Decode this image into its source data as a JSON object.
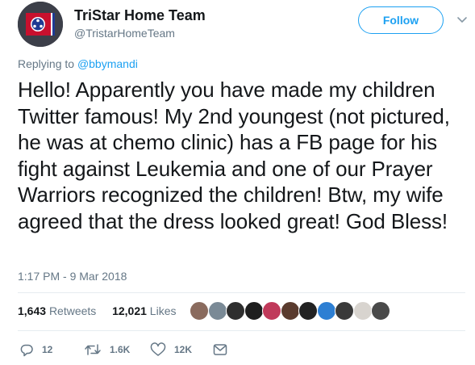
{
  "author": {
    "display_name": "TriStar Home Team",
    "handle": "@TristarHomeTeam",
    "avatar_icon": "tennessee-flag-avatar"
  },
  "header": {
    "follow_label": "Follow",
    "menu_icon": "chevron-down-icon"
  },
  "reply": {
    "prefix": "Replying to",
    "mention": "@bbymandi"
  },
  "tweet": {
    "text": "Hello! Apparently you have made my children Twitter famous! My 2nd youngest (not pictured, he was at chemo clinic) has a FB page for his fight against Leukemia and one of our Prayer Warriors recognized the children! Btw, my wife agreed that the dress looked great! God Bless!",
    "timestamp": "1:17 PM - 9 Mar 2018"
  },
  "stats": {
    "retweets_count": "1,643",
    "retweets_label": "Retweets",
    "likes_count": "12,021",
    "likes_label": "Likes",
    "likers_avatar_colors": [
      "#8a6b5e",
      "#7a8a96",
      "#2e2e2e",
      "#1e1e1e",
      "#c0395a",
      "#5a3b2e",
      "#222222",
      "#2d7fd3",
      "#3a3a3a",
      "#d8d4cf",
      "#4a4a4a"
    ]
  },
  "actions": [
    {
      "icon": "reply-icon",
      "count": "12"
    },
    {
      "icon": "retweet-icon",
      "count": "1.6K"
    },
    {
      "icon": "heart-icon",
      "count": "12K"
    },
    {
      "icon": "message-icon",
      "count": ""
    }
  ],
  "colors": {
    "accent": "#1da1f2",
    "secondary_text": "#657786",
    "primary_text": "#14171a"
  }
}
